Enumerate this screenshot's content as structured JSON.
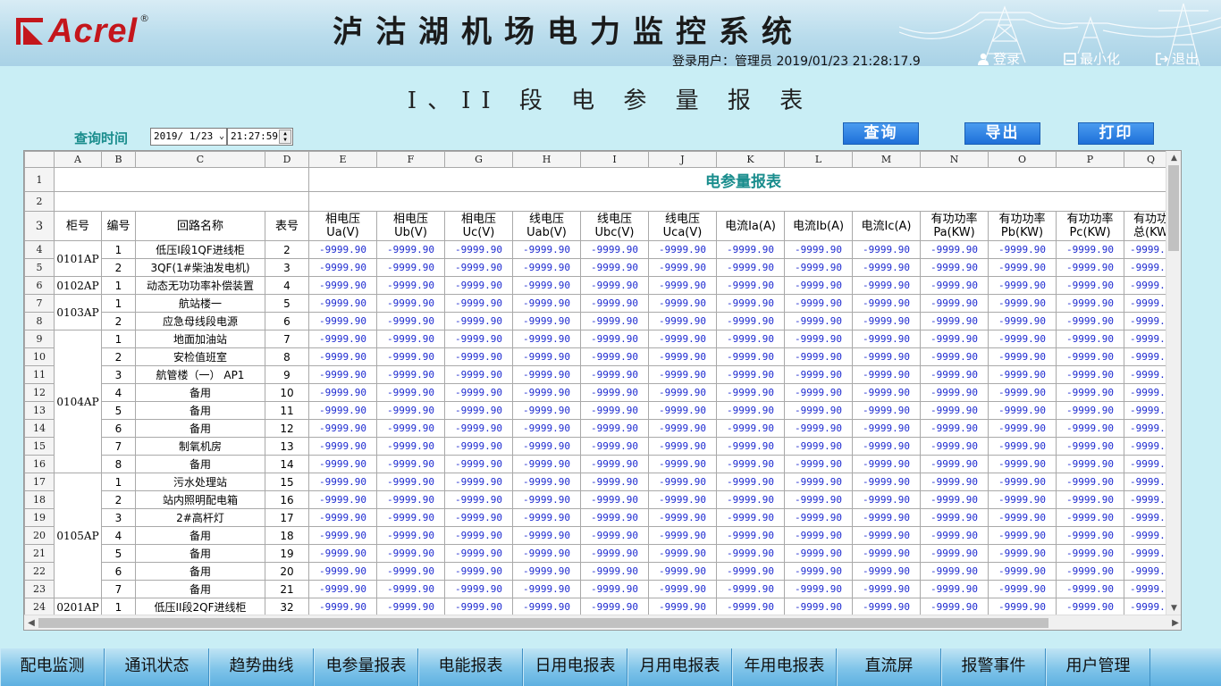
{
  "header": {
    "logo_text": "Acrel",
    "logo_reg": "®",
    "system_title": "泸沽湖机场电力监控系统",
    "user_info": "登录用户：管理员  2019/01/23  21:28:17.9",
    "login_label": "登录",
    "minimize_label": "最小化",
    "exit_label": "退出"
  },
  "page_title": "I、II 段 电 参 量 报 表",
  "query": {
    "label": "查询时间",
    "date": "2019/ 1/23",
    "time": "21:27:59",
    "query_button": "查询",
    "export_button": "导出",
    "print_button": "打印"
  },
  "sheet": {
    "col_letters": [
      "A",
      "B",
      "C",
      "D",
      "E",
      "F",
      "G",
      "H",
      "I",
      "J",
      "K",
      "L",
      "M",
      "N",
      "O",
      "P",
      "Q"
    ],
    "report_title": "电参量报表",
    "fixed_headers": [
      "柜号",
      "编号",
      "回路名称",
      "表号"
    ],
    "measure_headers": [
      [
        "相电压",
        "Ua(V)"
      ],
      [
        "相电压",
        "Ub(V)"
      ],
      [
        "相电压",
        "Uc(V)"
      ],
      [
        "线电压",
        "Uab(V)"
      ],
      [
        "线电压",
        "Ubc(V)"
      ],
      [
        "线电压",
        "Uca(V)"
      ],
      [
        "电流Ia(A)",
        ""
      ],
      [
        "电流Ib(A)",
        ""
      ],
      [
        "电流Ic(A)",
        ""
      ],
      [
        "有功功率",
        "Pa(KW)"
      ],
      [
        "有功功率",
        "Pb(KW)"
      ],
      [
        "有功功率",
        "Pc(KW)"
      ],
      [
        "有功功",
        "总(KW"
      ]
    ],
    "value": "-9999.90",
    "value_cut": "-9999.",
    "cabinets": [
      {
        "name": "0101AP",
        "rows": [
          {
            "no": "1",
            "circuit": "低压I段1QF进线柜",
            "meter": "2"
          },
          {
            "no": "2",
            "circuit": "3QF(1#柴油发电机)",
            "meter": "3"
          }
        ]
      },
      {
        "name": "0102AP",
        "rows": [
          {
            "no": "1",
            "circuit": "动态无功功率补偿装置",
            "meter": "4"
          }
        ]
      },
      {
        "name": "0103AP",
        "rows": [
          {
            "no": "1",
            "circuit": "航站楼一",
            "meter": "5"
          },
          {
            "no": "2",
            "circuit": "应急母线段电源",
            "meter": "6"
          }
        ]
      },
      {
        "name": "0104AP",
        "rows": [
          {
            "no": "1",
            "circuit": "地面加油站",
            "meter": "7"
          },
          {
            "no": "2",
            "circuit": "安检值班室",
            "meter": "8"
          },
          {
            "no": "3",
            "circuit": "航管楼（一） AP1",
            "meter": "9"
          },
          {
            "no": "4",
            "circuit": "备用",
            "meter": "10"
          },
          {
            "no": "5",
            "circuit": "备用",
            "meter": "11"
          },
          {
            "no": "6",
            "circuit": "备用",
            "meter": "12"
          },
          {
            "no": "7",
            "circuit": "制氧机房",
            "meter": "13"
          },
          {
            "no": "8",
            "circuit": "备用",
            "meter": "14"
          }
        ]
      },
      {
        "name": "0105AP",
        "rows": [
          {
            "no": "1",
            "circuit": "污水处理站",
            "meter": "15"
          },
          {
            "no": "2",
            "circuit": "站内照明配电箱",
            "meter": "16"
          },
          {
            "no": "3",
            "circuit": "2#高杆灯",
            "meter": "17"
          },
          {
            "no": "4",
            "circuit": "备用",
            "meter": "18"
          },
          {
            "no": "5",
            "circuit": "备用",
            "meter": "19"
          },
          {
            "no": "6",
            "circuit": "备用",
            "meter": "20"
          },
          {
            "no": "7",
            "circuit": "备用",
            "meter": "21"
          }
        ]
      },
      {
        "name": "0201AP",
        "rows": [
          {
            "no": "1",
            "circuit": "低压II段2QF进线柜",
            "meter": "32"
          }
        ]
      }
    ]
  },
  "nav": [
    "配电监测",
    "通讯状态",
    "趋势曲线",
    "电参量报表",
    "电能报表",
    "日用电报表",
    "月用电报表",
    "年用电报表",
    "直流屏",
    "报警事件",
    "用户管理"
  ]
}
